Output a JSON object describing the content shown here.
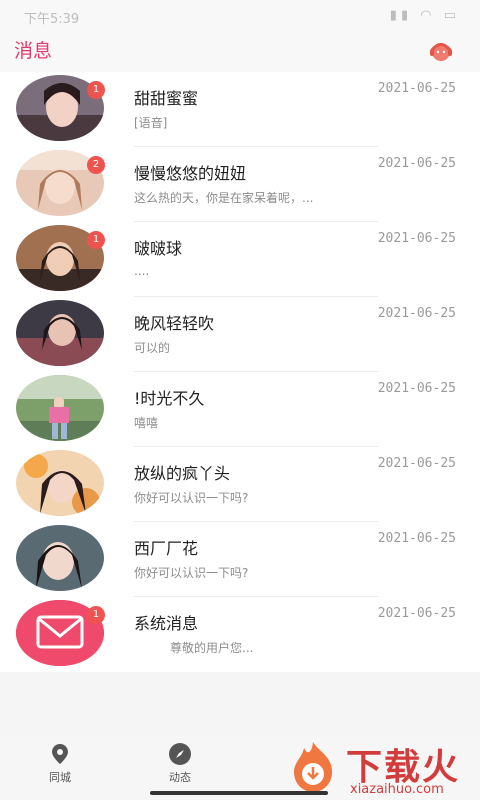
{
  "status_bar": {
    "time": "下午5:39",
    "icons": "▮▮ ◠ ▭"
  },
  "header": {
    "title": "消息"
  },
  "messages": [
    {
      "name": "甜甜蜜蜜",
      "date": "2021-06-25",
      "preview": "[语音]",
      "badge": "1"
    },
    {
      "name": "慢慢悠悠的妞妞",
      "date": "2021-06-25",
      "preview": "这么热的天，你是在家呆着呢，...",
      "badge": "2"
    },
    {
      "name": "啵啵球",
      "date": "2021-06-25",
      "preview": "....",
      "badge": "1"
    },
    {
      "name": "晚风轻轻吹",
      "date": "2021-06-25",
      "preview": "可以的",
      "badge": ""
    },
    {
      "name": "!时光不久",
      "date": "2021-06-25",
      "preview": "嘻嘻",
      "badge": ""
    },
    {
      "name": "放纵的疯丫头",
      "date": "2021-06-25",
      "preview": "你好可以认识一下吗?",
      "badge": ""
    },
    {
      "name": "西厂厂花",
      "date": "2021-06-25",
      "preview": "你好可以认识一下吗?",
      "badge": ""
    },
    {
      "name": "系统消息",
      "date": "2021-06-25",
      "preview": "尊敬的用户您...",
      "badge": "1"
    }
  ],
  "nav": {
    "tab1": "同城",
    "tab2": "动态"
  },
  "watermark": {
    "text": "下载火",
    "url": "xiazaihuo.com"
  },
  "colors": {
    "accent": "#e23a6b",
    "badge": "#ef5350",
    "system_avatar": "#ef4a6b"
  }
}
